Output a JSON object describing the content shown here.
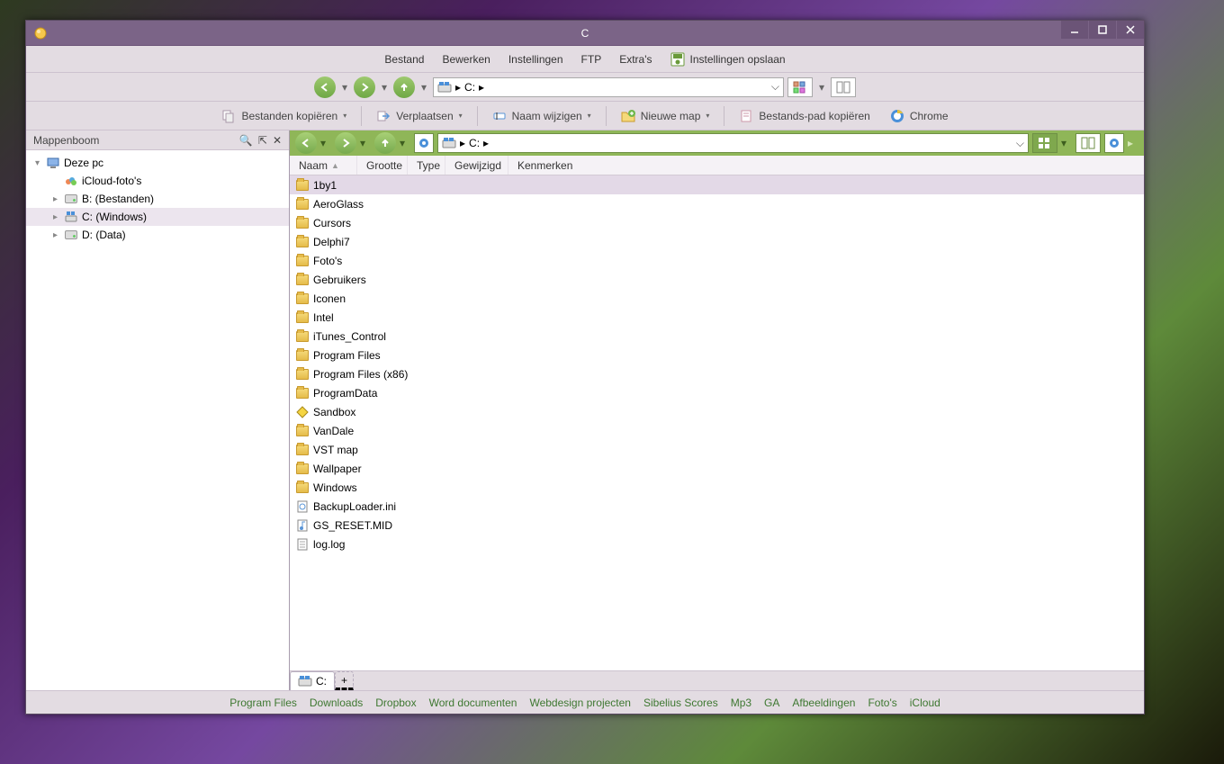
{
  "titlebar": {
    "title": "C"
  },
  "menubar": {
    "items": [
      "Bestand",
      "Bewerken",
      "Instellingen",
      "FTP",
      "Extra's"
    ],
    "save_settings": "Instellingen opslaan"
  },
  "navbar": {
    "path_label": "C:"
  },
  "toolbar": {
    "copy": "Bestanden kopiëren",
    "move": "Verplaatsen",
    "rename": "Naam wijzigen",
    "newfolder": "Nieuwe map",
    "copypath": "Bestands-pad kopiëren",
    "chrome": "Chrome"
  },
  "tree": {
    "title": "Mappenboom",
    "items": [
      {
        "label": "Deze pc",
        "level": 0,
        "icon": "pc",
        "expander": "▾"
      },
      {
        "label": "iCloud-foto's",
        "level": 1,
        "icon": "icloud",
        "expander": ""
      },
      {
        "label": "B: (Bestanden)",
        "level": 1,
        "icon": "drive",
        "expander": "▸"
      },
      {
        "label": "C: (Windows)",
        "level": 1,
        "icon": "windrive",
        "expander": "▸",
        "selected": true
      },
      {
        "label": "D: (Data)",
        "level": 1,
        "icon": "drive",
        "expander": "▸"
      }
    ]
  },
  "greenbar": {
    "path_label": "C:"
  },
  "columns": [
    "Naam",
    "Grootte",
    "Type",
    "Gewijzigd",
    "Kenmerken"
  ],
  "files": [
    {
      "name": "1by1",
      "icon": "folder",
      "selected": true
    },
    {
      "name": "AeroGlass",
      "icon": "folder"
    },
    {
      "name": "Cursors",
      "icon": "folder"
    },
    {
      "name": "Delphi7",
      "icon": "folder"
    },
    {
      "name": "Foto's",
      "icon": "folder"
    },
    {
      "name": "Gebruikers",
      "icon": "folder"
    },
    {
      "name": "Iconen",
      "icon": "folder"
    },
    {
      "name": "Intel",
      "icon": "folder"
    },
    {
      "name": "iTunes_Control",
      "icon": "folder"
    },
    {
      "name": "Program Files",
      "icon": "folder"
    },
    {
      "name": "Program Files (x86)",
      "icon": "folder"
    },
    {
      "name": "ProgramData",
      "icon": "folder"
    },
    {
      "name": "Sandbox",
      "icon": "sandbox"
    },
    {
      "name": "VanDale",
      "icon": "folder"
    },
    {
      "name": "VST map",
      "icon": "folder"
    },
    {
      "name": "Wallpaper",
      "icon": "folder"
    },
    {
      "name": "Windows",
      "icon": "folder"
    },
    {
      "name": "BackupLoader.ini",
      "icon": "ini"
    },
    {
      "name": "GS_RESET.MID",
      "icon": "audio"
    },
    {
      "name": "log.log",
      "icon": "text"
    }
  ],
  "tab": {
    "label": "C:"
  },
  "links": [
    "Program Files",
    "Downloads",
    "Dropbox",
    "Word documenten",
    "Webdesign projecten",
    "Sibelius Scores",
    "Mp3",
    "GA",
    "Afbeeldingen",
    "Foto's",
    "iCloud"
  ]
}
